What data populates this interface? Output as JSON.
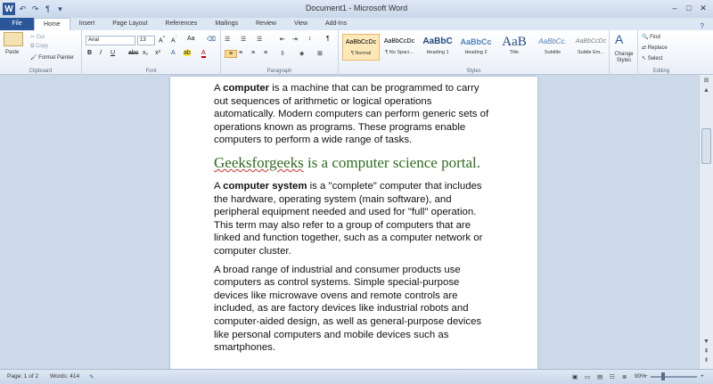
{
  "window": {
    "title": "Document1 - Microsoft Word",
    "app_letter": "W",
    "controls": [
      "–",
      "□",
      "✕"
    ]
  },
  "quick_access": [
    "↶",
    "↷",
    "¶",
    "▾"
  ],
  "tabs": [
    {
      "label": "File"
    },
    {
      "label": "Home"
    },
    {
      "label": "Insert"
    },
    {
      "label": "Page Layout"
    },
    {
      "label": "References"
    },
    {
      "label": "Mailings"
    },
    {
      "label": "Review"
    },
    {
      "label": "View"
    },
    {
      "label": "Add-Ins"
    }
  ],
  "ribbon": {
    "clipboard": {
      "paste": "Paste",
      "cut": "Cut",
      "copy": "Copy",
      "format_painter": "Format Painter",
      "label": "Clipboard"
    },
    "font": {
      "family": "Arial",
      "size": "13",
      "label": "Font"
    },
    "paragraph": {
      "label": "Paragraph"
    },
    "styles": {
      "label": "Styles",
      "items": [
        {
          "preview": "AaBbCcDc",
          "name": "¶ Normal"
        },
        {
          "preview": "AaBbCcDc",
          "name": "¶ No Spaci..."
        },
        {
          "preview": "AaBbC",
          "name": "Heading 1"
        },
        {
          "preview": "AaBbCc",
          "name": "Heading 2"
        },
        {
          "preview": "AaB",
          "name": "Title"
        },
        {
          "preview": "AaBbCc.",
          "name": "Subtitle"
        },
        {
          "preview": "AaBbCcDc",
          "name": "Subtle Em..."
        }
      ],
      "change_styles": "Change Styles"
    },
    "editing": {
      "find": "Find",
      "replace": "Replace",
      "select": "Select",
      "label": "Editing"
    }
  },
  "document": {
    "para1_before": "A ",
    "para1_bold": "computer",
    "para1_after": " is a machine that can be programmed to carry out sequences of arithmetic or logical operations automatically. Modern computers can perform generic sets of operations known as programs. These programs enable computers to perform a wide range of tasks.",
    "heading_word": "Geeksforgeeks",
    "heading_rest": " is a computer science portal.",
    "para2_before": " A ",
    "para2_bold": "computer system",
    "para2_after": " is a \"complete\" computer that includes the hardware, operating system (main software), and peripheral equipment needed and used for \"full\" operation. This term may also refer to a group of computers that are linked and function together, such as a computer network or computer cluster.",
    "para3": "A broad range of industrial and consumer products use computers as control systems. Simple special-purpose devices like microwave ovens and remote controls are included, as are factory devices like industrial robots and computer-aided design, as well as general-purpose devices like personal computers and mobile devices such as smartphones."
  },
  "status": {
    "page": "Page: 1 of 2",
    "words": "Words: 414",
    "zoom": "90%"
  }
}
